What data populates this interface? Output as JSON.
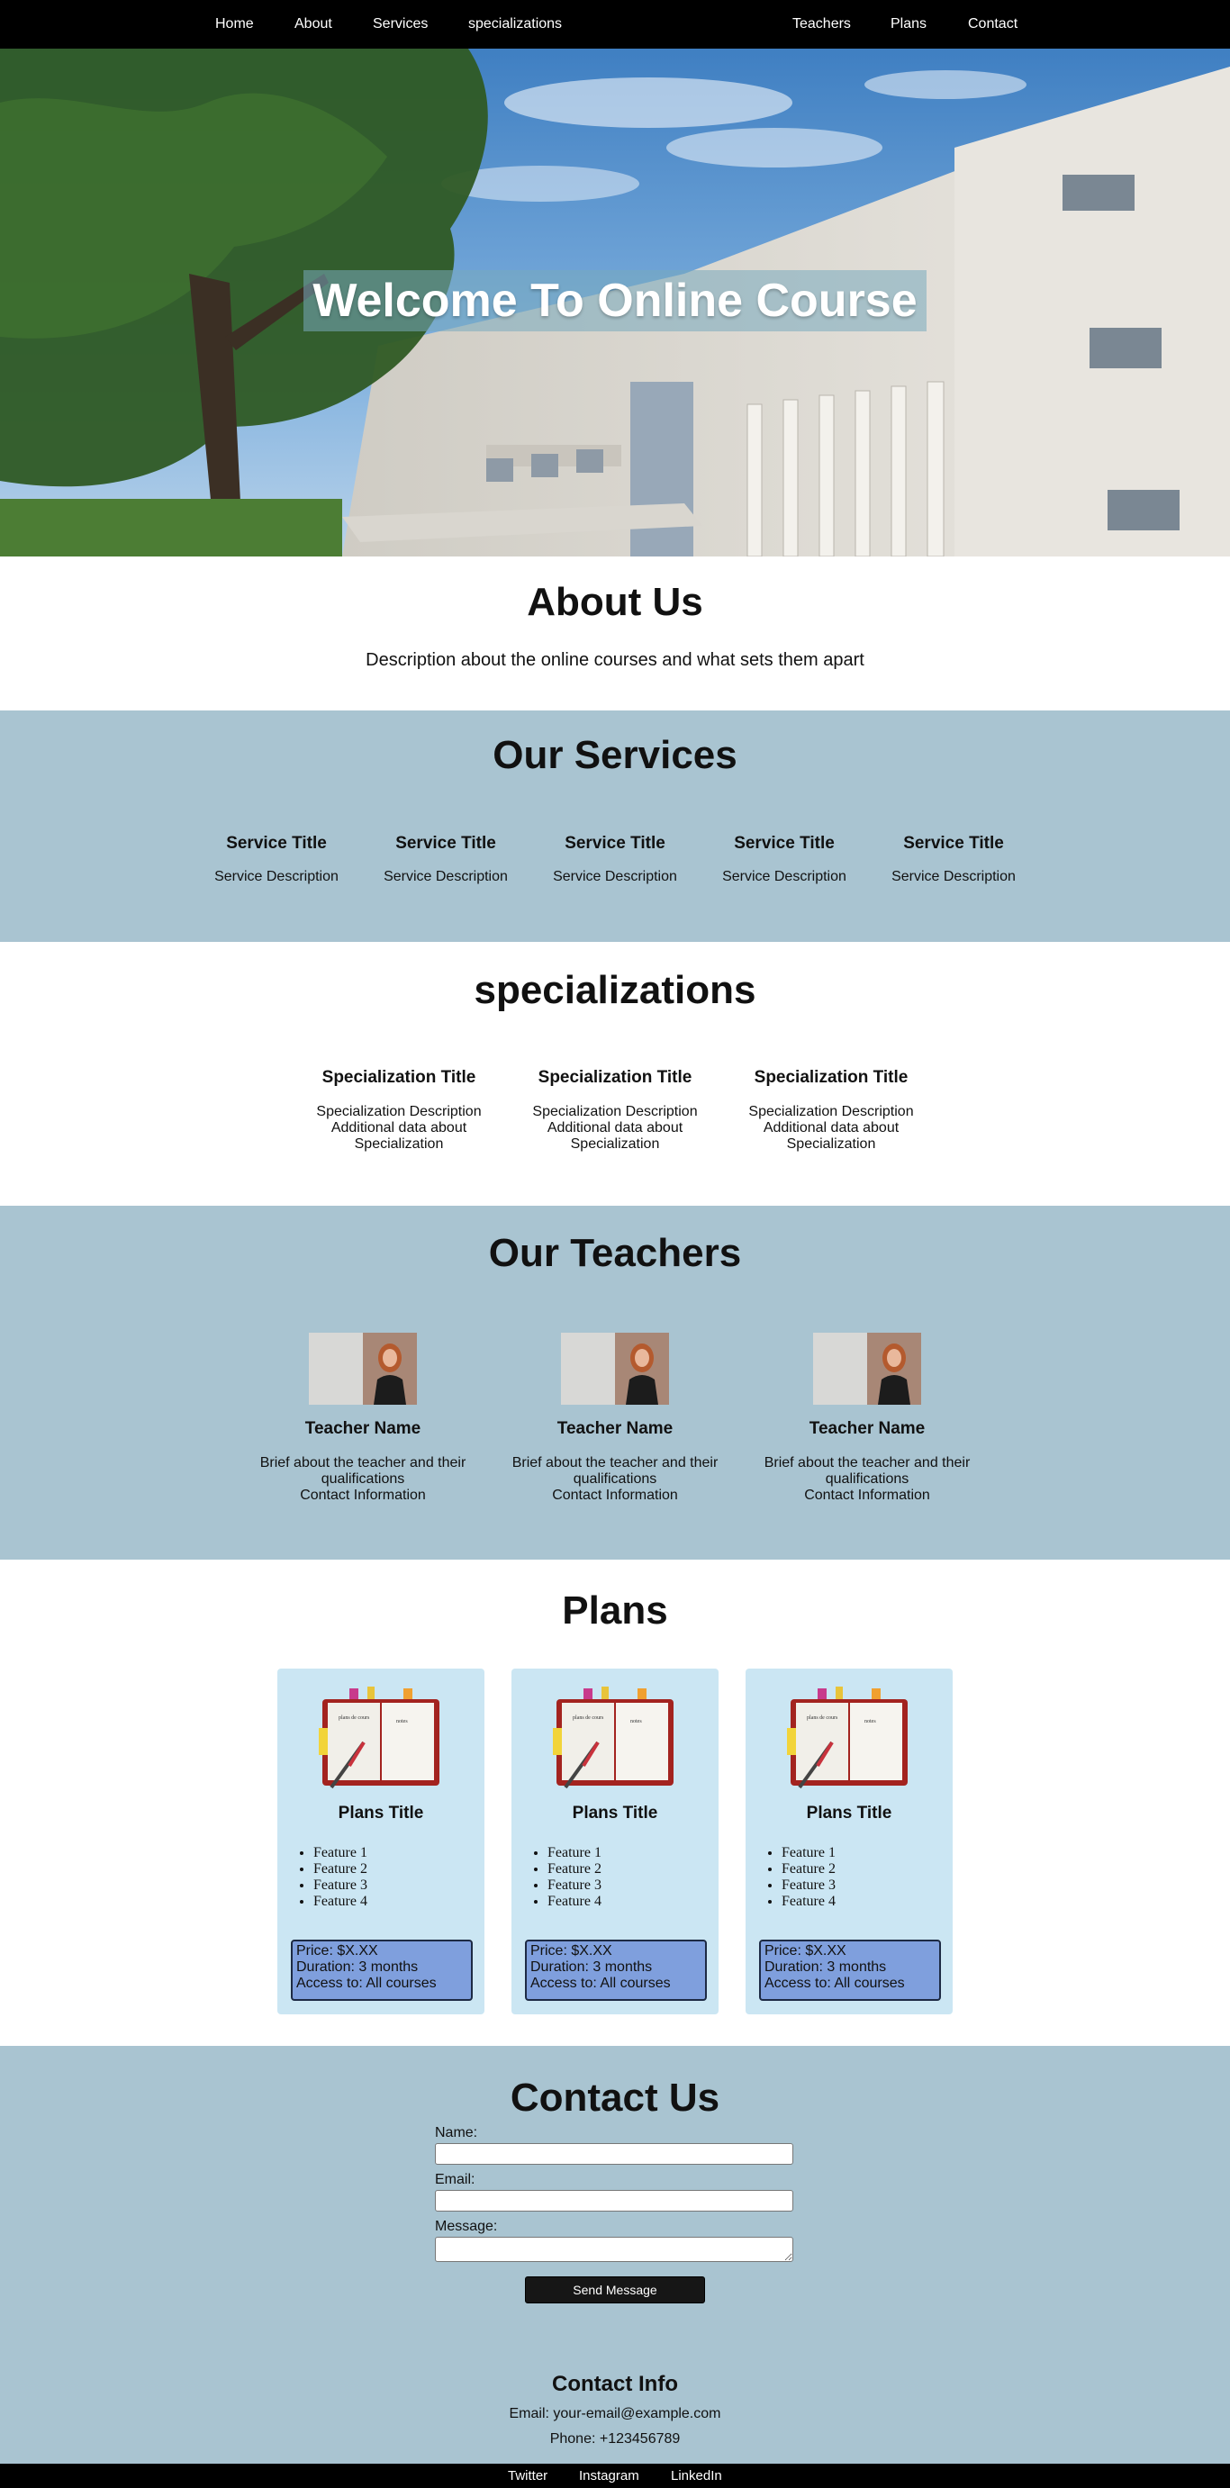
{
  "nav": {
    "left": [
      "Home",
      "About",
      "Services",
      "specializations"
    ],
    "right": [
      "Teachers",
      "Plans",
      "Contact"
    ]
  },
  "hero": {
    "title": "Welcome To Online Course"
  },
  "about": {
    "title": "About Us",
    "description": "Description about the online courses and what sets them apart"
  },
  "services": {
    "title": "Our Services",
    "items": [
      {
        "title": "Service Title",
        "description": "Service Description"
      },
      {
        "title": "Service Title",
        "description": "Service Description"
      },
      {
        "title": "Service Title",
        "description": "Service Description"
      },
      {
        "title": "Service Title",
        "description": "Service Description"
      },
      {
        "title": "Service Title",
        "description": "Service Description"
      }
    ]
  },
  "specializations": {
    "title": "specializations",
    "items": [
      {
        "title": "Specialization Title",
        "line1": "Specialization Description",
        "line2": "Additional data about",
        "line3": "Specialization"
      },
      {
        "title": "Specialization Title",
        "line1": "Specialization Description",
        "line2": "Additional data about",
        "line3": "Specialization"
      },
      {
        "title": "Specialization Title",
        "line1": "Specialization Description",
        "line2": "Additional data about",
        "line3": "Specialization"
      }
    ]
  },
  "teachers": {
    "title": "Our Teachers",
    "items": [
      {
        "name": "Teacher Name",
        "brief1": "Brief about the teacher and their",
        "brief2": "qualifications",
        "contact": "Contact Information"
      },
      {
        "name": "Teacher Name",
        "brief1": "Brief about the teacher and their",
        "brief2": "qualifications",
        "contact": "Contact Information"
      },
      {
        "name": "Teacher Name",
        "brief1": "Brief about the teacher and their",
        "brief2": "qualifications",
        "contact": "Contact Information"
      }
    ]
  },
  "plans": {
    "title": "Plans",
    "book_text_left": "plans de cours",
    "book_text_right": "notes",
    "items": [
      {
        "title": "Plans Title",
        "features": [
          "Feature 1",
          "Feature 2",
          "Feature 3",
          "Feature 4"
        ],
        "price": "Price: $X.XX",
        "duration": "Duration: 3 months",
        "access": "Access to: All courses"
      },
      {
        "title": "Plans Title",
        "features": [
          "Feature 1",
          "Feature 2",
          "Feature 3",
          "Feature 4"
        ],
        "price": "Price: $X.XX",
        "duration": "Duration: 3 months",
        "access": "Access to: All courses"
      },
      {
        "title": "Plans Title",
        "features": [
          "Feature 1",
          "Feature 2",
          "Feature 3",
          "Feature 4"
        ],
        "price": "Price: $X.XX",
        "duration": "Duration: 3 months",
        "access": "Access to: All courses"
      }
    ]
  },
  "contact": {
    "title": "Contact Us",
    "name_label": "Name:",
    "email_label": "Email:",
    "message_label": "Message:",
    "send_label": "Send Message",
    "info_title": "Contact Info",
    "email": "Email: your-email@example.com",
    "phone": "Phone: +123456789"
  },
  "footer": {
    "links": [
      "Twitter",
      "Instagram",
      "LinkedIn"
    ]
  },
  "colors": {
    "nav_bg": "#000000",
    "section_alt_bg": "#a9c4d1",
    "plan_card_bg": "#cbe6f3",
    "price_box_bg": "#7f9fdd"
  }
}
